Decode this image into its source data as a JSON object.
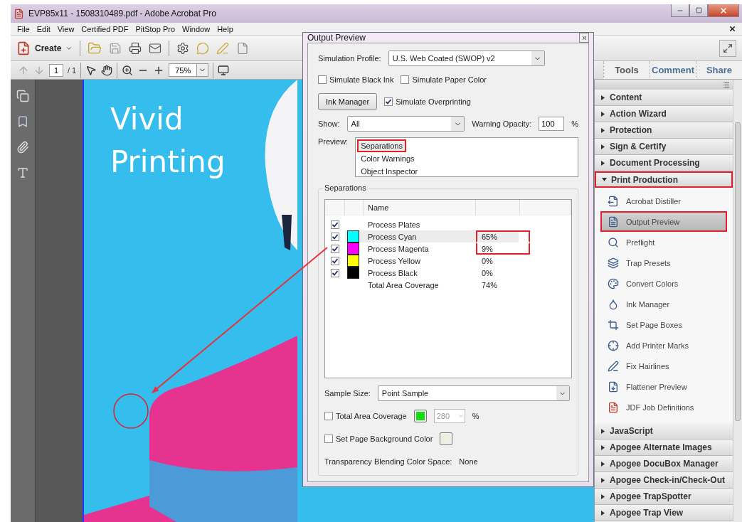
{
  "window": {
    "title": "EVP85x11 - 1508310489.pdf - Adobe Acrobat Pro"
  },
  "menu": [
    {
      "label": "File"
    },
    {
      "label": "Edit"
    },
    {
      "label": "View"
    },
    {
      "label": "Certified PDF"
    },
    {
      "label": "PitStop Pro"
    },
    {
      "label": "Window"
    },
    {
      "label": "Help"
    }
  ],
  "toolbar": {
    "create_label": "Create"
  },
  "navigation": {
    "page": "1",
    "page_total": "/ 1",
    "zoom": "75%"
  },
  "panel_tabs": [
    {
      "label": "Tools",
      "selected": true
    },
    {
      "label": "Comment",
      "selected": false
    },
    {
      "label": "Share",
      "selected": false
    }
  ],
  "document": {
    "headline": [
      "Vivid",
      "Printing"
    ]
  },
  "output_preview": {
    "title": "Output Preview",
    "simulation_profile": {
      "label": "Simulation Profile:",
      "value": "U.S. Web Coated (SWOP) v2"
    },
    "options": [
      {
        "label": "Simulate Black Ink",
        "checked": false
      },
      {
        "label": "Simulate Paper Color",
        "checked": false
      }
    ],
    "ink_manager_button": "Ink Manager",
    "overprint": {
      "label": "Simulate Overprinting",
      "checked": true
    },
    "show": {
      "label": "Show:",
      "value": "All"
    },
    "warning_opacity": {
      "label": "Warning Opacity:",
      "value": "100",
      "unit": "%"
    },
    "preview": {
      "label": "Preview:",
      "items": [
        {
          "label": "Separations",
          "selected": true,
          "highlighted": true
        },
        {
          "label": "Color Warnings",
          "selected": false,
          "highlighted": false
        },
        {
          "label": "Object Inspector",
          "selected": false,
          "highlighted": false
        }
      ]
    },
    "separations": {
      "title": "Separations",
      "columns": [
        "Name"
      ],
      "rows": [
        {
          "kind": "plates",
          "name": "Process Plates",
          "checked": true,
          "selected": false
        },
        {
          "kind": "ink",
          "name": "Process Cyan",
          "checked": true,
          "color": "#00ffff",
          "coverage": "65%",
          "selected": true,
          "highlighted": true
        },
        {
          "kind": "ink",
          "name": "Process Magenta",
          "checked": true,
          "color": "#ff00ff",
          "coverage": "9%",
          "selected": false,
          "highlighted": true
        },
        {
          "kind": "ink",
          "name": "Process Yellow",
          "checked": true,
          "color": "#ffff00",
          "coverage": "0%",
          "selected": false,
          "highlighted": false
        },
        {
          "kind": "ink",
          "name": "Process Black",
          "checked": true,
          "color": "#000000",
          "coverage": "0%",
          "selected": false,
          "highlighted": false
        },
        {
          "kind": "total",
          "name": "Total Area Coverage",
          "coverage": "74%",
          "selected": false,
          "highlighted": false
        }
      ]
    },
    "sample_size": {
      "label": "Sample Size:",
      "value": "Point Sample"
    },
    "total_area_coverage": {
      "label": "Total Area Coverage",
      "checked": false,
      "value": "280",
      "unit": "%",
      "disabled": true
    },
    "page_background": {
      "label": "Set Page Background Color",
      "checked": false
    },
    "blending": {
      "label": "Transparency Blending Color Space:",
      "value": "None"
    }
  },
  "tools_panel": {
    "sections": [
      {
        "label": "Content",
        "expanded": false,
        "highlighted": false
      },
      {
        "label": "Action Wizard",
        "expanded": false,
        "highlighted": false
      },
      {
        "label": "Protection",
        "expanded": false,
        "highlighted": false
      },
      {
        "label": "Sign & Certify",
        "expanded": false,
        "highlighted": false
      },
      {
        "label": "Document Processing",
        "expanded": false,
        "highlighted": false
      },
      {
        "label": "Print Production",
        "expanded": true,
        "highlighted": true,
        "items": [
          {
            "label": "Acrobat Distiller",
            "selected": false,
            "highlighted": false
          },
          {
            "label": "Output Preview",
            "selected": true,
            "highlighted": true
          },
          {
            "label": "Preflight",
            "selected": false,
            "highlighted": false
          },
          {
            "label": "Trap Presets",
            "selected": false,
            "highlighted": false
          },
          {
            "label": "Convert Colors",
            "selected": false,
            "highlighted": false
          },
          {
            "label": "Ink Manager",
            "selected": false,
            "highlighted": false
          },
          {
            "label": "Set Page Boxes",
            "selected": false,
            "highlighted": false
          },
          {
            "label": "Add Printer Marks",
            "selected": false,
            "highlighted": false
          },
          {
            "label": "Fix Hairlines",
            "selected": false,
            "highlighted": false
          },
          {
            "label": "Flattener Preview",
            "selected": false,
            "highlighted": false
          },
          {
            "label": "JDF Job Definitions",
            "selected": false,
            "highlighted": false
          }
        ]
      },
      {
        "label": "JavaScript",
        "expanded": false,
        "highlighted": false
      },
      {
        "label": "Apogee Alternate Images",
        "expanded": false,
        "highlighted": false
      },
      {
        "label": "Apogee DocuBox Manager",
        "expanded": false,
        "highlighted": false
      },
      {
        "label": "Apogee Check-in/Check-Out",
        "expanded": false,
        "highlighted": false
      },
      {
        "label": "Apogee TrapSpotter",
        "expanded": false,
        "highlighted": false
      },
      {
        "label": "Apogee Trap View",
        "expanded": false,
        "highlighted": false
      }
    ]
  }
}
